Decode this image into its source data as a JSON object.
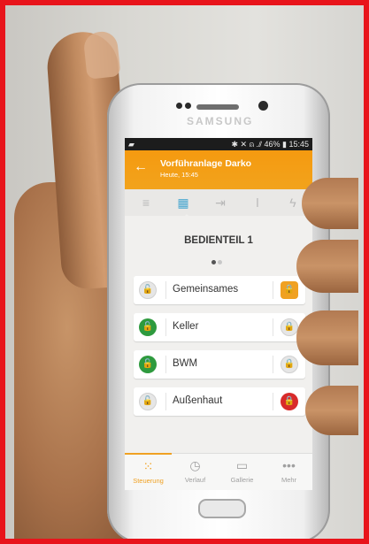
{
  "phone": {
    "brand": "SAMSUNG"
  },
  "status_bar": {
    "left_icon": "chat-icon",
    "right_text": "✱ ✕ ⍝ .⫽ 46% ▮ 15:45"
  },
  "header": {
    "back_icon": "back-arrow-icon",
    "title": "Vorführanlage Darko",
    "subtitle": "Heute, 15:45",
    "accent_color": "#f59a10"
  },
  "tabs": [
    {
      "icon": "list-icon",
      "glyph": "≡",
      "active": false
    },
    {
      "icon": "keypad-icon",
      "glyph": "▦",
      "active": true
    },
    {
      "icon": "exit-icon",
      "glyph": "⇥",
      "active": false
    },
    {
      "icon": "thermometer-icon",
      "glyph": "🌡",
      "active": false
    },
    {
      "icon": "lightning-icon",
      "glyph": "ϟ",
      "active": false
    }
  ],
  "section": {
    "title": "BEDIENTEIL 1"
  },
  "areas": [
    {
      "label": "Gemeinsames",
      "left_lock": "grey",
      "right_lock": "orange"
    },
    {
      "label": "Keller",
      "left_lock": "green",
      "right_lock": "grey"
    },
    {
      "label": "BWM",
      "left_lock": "green",
      "right_lock": "grey"
    },
    {
      "label": "Außenhaut",
      "left_lock": "grey",
      "right_lock": "red"
    }
  ],
  "bottom_nav": [
    {
      "label": "Steuerung",
      "icon": "keypad-icon",
      "glyph": "⁙",
      "active": true
    },
    {
      "label": "Verlauf",
      "icon": "clock-icon",
      "glyph": "◷",
      "active": false
    },
    {
      "label": "Gallerie",
      "icon": "video-icon",
      "glyph": "▭",
      "active": false
    },
    {
      "label": "Mehr",
      "icon": "more-icon",
      "glyph": "•••",
      "active": false
    }
  ]
}
